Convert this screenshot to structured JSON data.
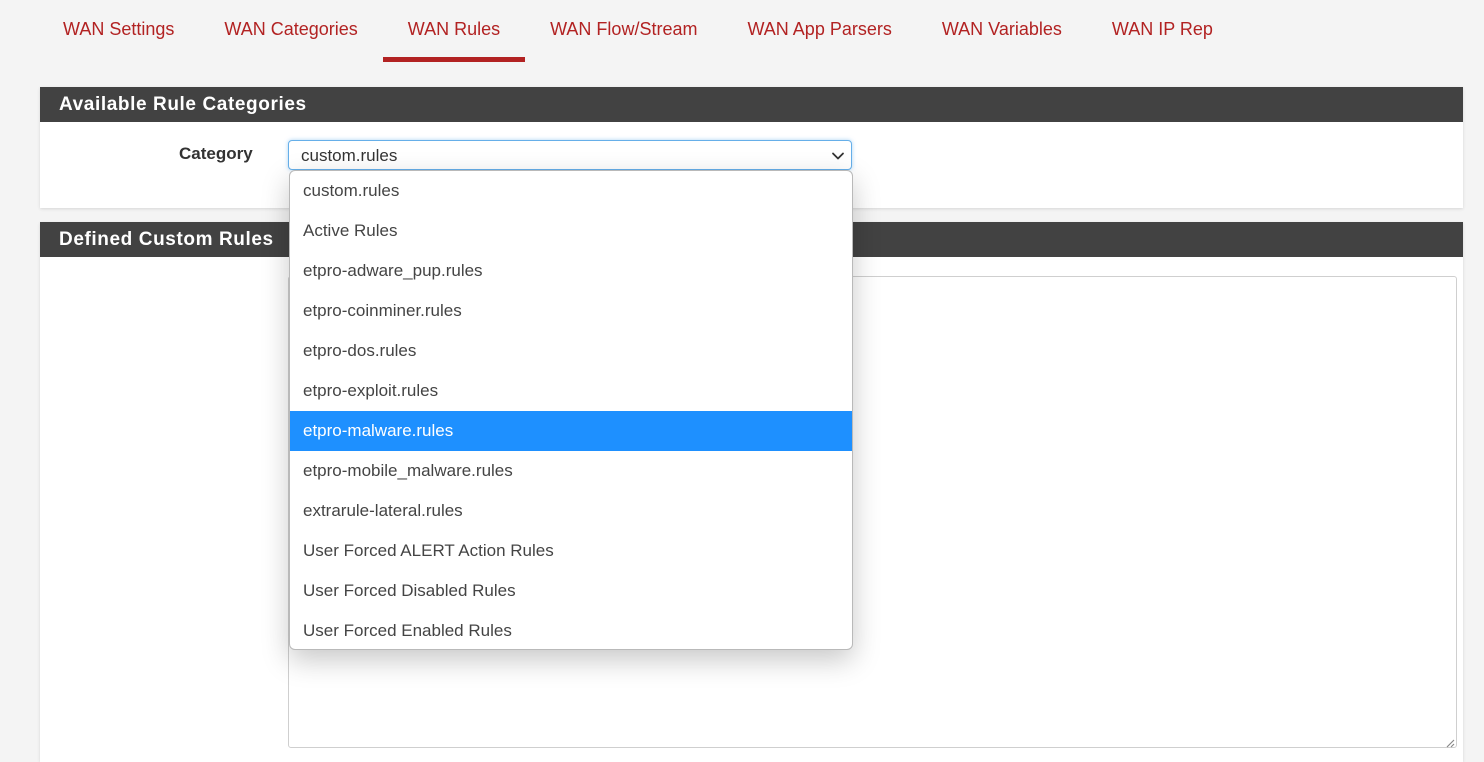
{
  "tabs": [
    {
      "label": "WAN Settings",
      "active": false
    },
    {
      "label": "WAN Categories",
      "active": false
    },
    {
      "label": "WAN Rules",
      "active": true
    },
    {
      "label": "WAN Flow/Stream",
      "active": false
    },
    {
      "label": "WAN App Parsers",
      "active": false
    },
    {
      "label": "WAN Variables",
      "active": false
    },
    {
      "label": "WAN IP Rep",
      "active": false
    }
  ],
  "panels": {
    "categories": {
      "heading": "Available Rule Categories",
      "category_label": "Category",
      "selected_value": "custom.rules"
    },
    "custom_rules": {
      "heading": "Defined Custom Rules",
      "textarea_value": ""
    }
  },
  "dropdown": {
    "options": [
      "custom.rules",
      "Active Rules",
      "etpro-adware_pup.rules",
      "etpro-coinminer.rules",
      "etpro-dos.rules",
      "etpro-exploit.rules",
      "etpro-malware.rules",
      "etpro-mobile_malware.rules",
      "extrarule-lateral.rules",
      "User Forced ALERT Action Rules",
      "User Forced Disabled Rules",
      "User Forced Enabled Rules"
    ],
    "highlighted_option": "etpro-malware.rules"
  },
  "colors": {
    "accent": "#b22222",
    "heading_bg": "#424242",
    "highlight": "#1e90ff",
    "focus_border": "#66afe9"
  },
  "icons": {
    "select_indicator": "chevron-down-icon",
    "textarea_resize": "resize-grip-icon"
  }
}
